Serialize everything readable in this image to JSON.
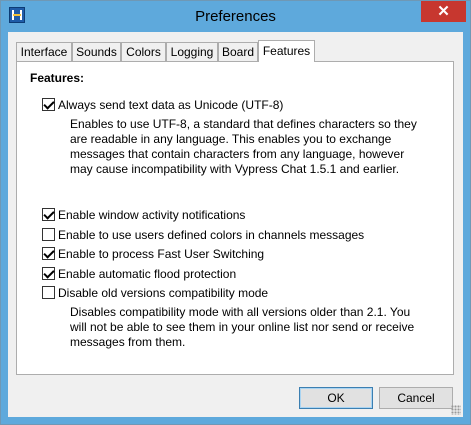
{
  "window": {
    "title": "Preferences",
    "close_glyph": "✕"
  },
  "tabs": [
    {
      "label": "Interface",
      "active": false
    },
    {
      "label": "Sounds",
      "active": false
    },
    {
      "label": "Colors",
      "active": false
    },
    {
      "label": "Logging",
      "active": false
    },
    {
      "label": "Board",
      "active": false
    },
    {
      "label": "Features",
      "active": true
    }
  ],
  "features": {
    "title": "Features:",
    "options": [
      {
        "label": "Always send text data as Unicode (UTF-8)",
        "checked": true
      },
      {
        "label": "Enable window activity notifications",
        "checked": true
      },
      {
        "label": "Enable to use users defined colors in channels messages",
        "checked": false
      },
      {
        "label": "Enable to process Fast User Switching",
        "checked": true
      },
      {
        "label": "Enable automatic flood protection",
        "checked": true
      },
      {
        "label": "Disable old versions compatibility mode",
        "checked": false
      }
    ],
    "unicode_desc": "Enables to use UTF-8, a standard that defines characters so they are readable in any language. This enables you to exchange messages that contain characters from any language, however may cause incompatibility with Vypress Chat 1.5.1 and earlier.",
    "compat_desc": "Disables compatibility mode with all versions older than 2.1. You will not be able to see them in your online list nor send or receive messages from them."
  },
  "buttons": {
    "ok": "OK",
    "cancel": "Cancel"
  },
  "colors": {
    "titlebar": "#5ea9dc",
    "close": "#c7372f"
  }
}
